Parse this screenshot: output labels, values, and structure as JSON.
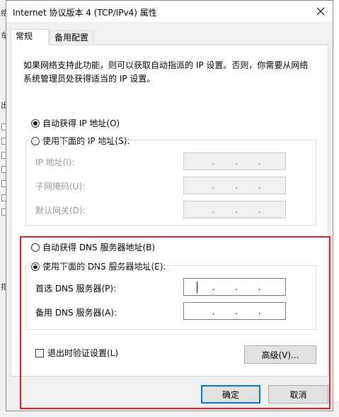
{
  "window": {
    "title": "Internet 协议版本 4 (TCP/IPv4) 属性"
  },
  "tabs": [
    {
      "label": "常规",
      "active": true
    },
    {
      "label": "备用配置",
      "active": false
    }
  ],
  "description": "如果网络支持此功能，则可以获取自动指派的 IP 设置。否则，你需要从网络系统管理员处获得适当的 IP 设置。",
  "ip": {
    "auto_label": "自动获得 IP 地址(O)",
    "manual_label": "使用下面的 IP 地址(S):",
    "selected": "auto",
    "fields": [
      {
        "label": "IP 地址(I):",
        "value": ". . ."
      },
      {
        "label": "子网掩码(U):",
        "value": ". . ."
      },
      {
        "label": "默认网关(D):",
        "value": ". . ."
      }
    ]
  },
  "dns": {
    "auto_label": "自动获得 DNS 服务器地址(B)",
    "manual_label": "使用下面的 DNS 服务器地址(E):",
    "selected": "manual",
    "preferred_label": "首选 DNS 服务器(P):",
    "alternate_label": "备用 DNS 服务器(A):"
  },
  "validate_label": "退出时验证设置(L)",
  "advanced_label": "高级(V)...",
  "ok_label": "确定",
  "cancel_label": "取消",
  "background": {
    "labels": [
      "络",
      "车",
      "出",
      "指"
    ]
  },
  "colors": {
    "highlight": "#e02020",
    "accent": "#0078d7"
  }
}
